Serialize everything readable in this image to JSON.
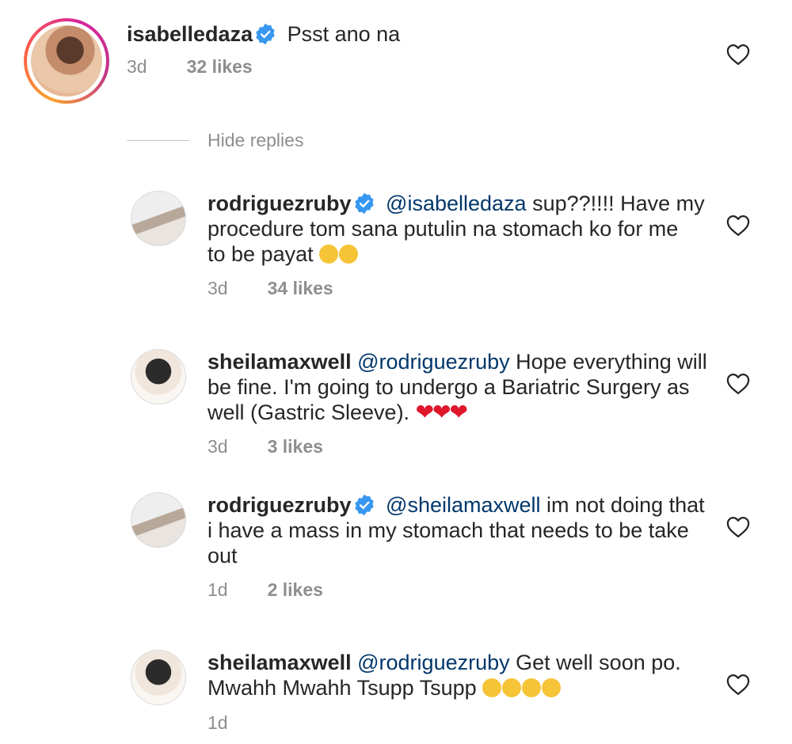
{
  "comment": {
    "username": "isabelledaza",
    "text": "Psst ano na",
    "time": "3d",
    "likes": "32 likes"
  },
  "hide_replies": "Hide replies",
  "replies": [
    {
      "username": "rodriguezruby",
      "mention": "@isabelledaza",
      "text_line1": "sup??!!!! Have my",
      "text_line2": "procedure tom sana putulin na stomach ko for me",
      "text_line3": "to be payat",
      "time": "3d",
      "likes": "34 likes"
    },
    {
      "username": "sheilamaxwell",
      "mention": "@rodriguezruby",
      "text_line1": "Hope everything will",
      "text_line2": "be fine. I'm going to undergo a Bariatric Surgery as",
      "text_line3": "well (Gastric Sleeve).",
      "emoji": "❤❤❤",
      "time": "3d",
      "likes": "3 likes"
    },
    {
      "username": "rodriguezruby",
      "mention": "@sheilamaxwell",
      "text_line1": "im not doing that",
      "text_line2": "i have a mass in my stomach that needs to be take",
      "text_line3": "out",
      "time": "1d",
      "likes": "2 likes"
    },
    {
      "username": "sheilamaxwell",
      "mention": "@rodriguezruby",
      "text_line1": "Get well soon po.",
      "text_line2": "Mwahh Mwahh Tsupp Tsupp",
      "time": "1d"
    }
  ],
  "colors": {
    "verified": "#3897f0",
    "mention": "#00376b",
    "meta": "#8e8e8e",
    "story_ring_start": "#f9a12e",
    "story_ring_end": "#c13584"
  },
  "icons": {
    "like": "heart-outline-icon",
    "verified": "verified-badge-icon"
  }
}
